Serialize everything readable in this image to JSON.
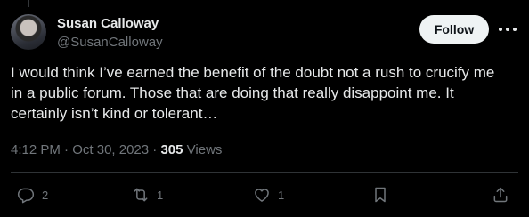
{
  "author": {
    "name": "Susan Calloway",
    "handle": "@SusanCalloway"
  },
  "follow_label": "Follow",
  "tweet": {
    "text": "I would think I’ve earned the benefit of the doubt not a rush to crucify me in a public forum. Those that are doing that really disappoint me. It certainly isn’t kind or tolerant…",
    "time": "4:12 PM",
    "separator": "·",
    "date": "Oct 30, 2023",
    "views_count": "305",
    "views_label": "Views"
  },
  "actions": {
    "replies": "2",
    "reposts": "1",
    "likes": "1"
  },
  "icons": [
    "avatar",
    "more-icon",
    "reply-icon",
    "repost-icon",
    "like-icon",
    "bookmark-icon",
    "share-icon"
  ],
  "colors": {
    "background": "#000000",
    "text": "#e7e9ea",
    "muted": "#71767b",
    "button_bg": "#eff3f4",
    "divider": "#2f3336"
  }
}
